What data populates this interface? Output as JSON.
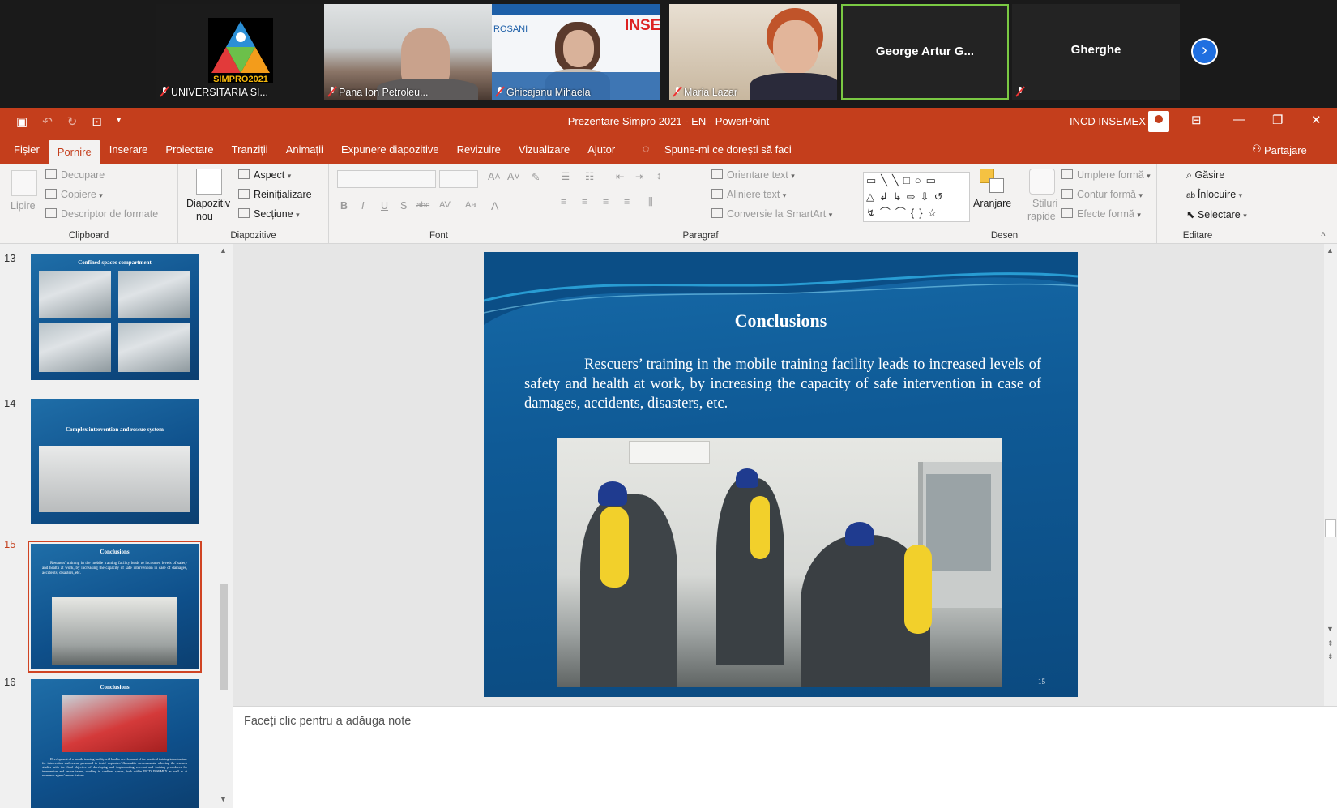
{
  "meeting": {
    "participants": [
      {
        "name": "UNIVERSITARIA SI...",
        "logo_text": "SIMPRO2021"
      },
      {
        "name": "Pana Ion Petroleu..."
      },
      {
        "name": "Ghicajanu Mihaela",
        "slide_text_left": "ROSANI",
        "slide_text_right": "INSE"
      },
      {
        "name": "Maria Lazar"
      },
      {
        "name": "George Artur G..."
      },
      {
        "name": "Gherghe"
      }
    ],
    "next_icon": "chevron-right-icon"
  },
  "app": {
    "title": "Prezentare Simpro 2021 - EN  -  PowerPoint",
    "user": "INCD INSEMEX",
    "qat": [
      "save-icon",
      "undo-icon",
      "redo-icon",
      "present-icon",
      "customize-icon"
    ]
  },
  "tabs": [
    "Fișier",
    "Pornire",
    "Inserare",
    "Proiectare",
    "Tranziții",
    "Animații",
    "Expunere diapozitive",
    "Revizuire",
    "Vizualizare",
    "Ajutor"
  ],
  "tell_me": "Spune-mi ce dorești să faci",
  "share": "Partajare",
  "ribbon": {
    "clipboard": {
      "label": "Clipboard",
      "paste": "Lipire",
      "cut": "Decupare",
      "copy": "Copiere",
      "format_painter": "Descriptor de formate"
    },
    "slides": {
      "label": "Diapozitive",
      "new_slide_1": "Diapozitiv",
      "new_slide_2": "nou",
      "layout": "Aspect",
      "reset": "Reinițializare",
      "section": "Secțiune"
    },
    "font": {
      "label": "Font",
      "bold": "B",
      "italic": "I",
      "underline": "U",
      "shadow": "S",
      "strike": "abc",
      "spacing": "AV",
      "case": "Aa",
      "color": "A"
    },
    "paragraph": {
      "label": "Paragraf",
      "text_direction": "Orientare text",
      "align_text": "Aliniere text",
      "smartart": "Conversie la SmartArt"
    },
    "drawing": {
      "label": "Desen",
      "arrange": "Aranjare",
      "quick_styles_1": "Stiluri",
      "quick_styles_2": "rapide",
      "fill": "Umplere formă",
      "outline": "Contur formă",
      "effects": "Efecte formă"
    },
    "editing": {
      "label": "Editare",
      "find": "Găsire",
      "replace": "Înlocuire",
      "select": "Selectare"
    }
  },
  "thumbnails": [
    {
      "num": "13",
      "title": "Confined spaces compartment"
    },
    {
      "num": "14",
      "title": "Complex intervention and rescue system"
    },
    {
      "num": "15",
      "title": "Conclusions",
      "text": "Rescuers' training in the mobile training facility leads to increased levels of safety and health at work, by increasing the capacity of safe intervention in case of damages, accidents, disasters, etc."
    },
    {
      "num": "16",
      "title": "Conclusions",
      "text": "Development of a mobile training facility will lead to development of the practical training infrastructure for intervention and rescue personnel in toxic/ explosive/ flammable environments, allowing the research studies with the final objective of developing and implementing relevant and training procedures for intervention and rescue teams, working in confined spaces, both within INCD INSEMEX as well as at economic agents' rescue stations."
    }
  ],
  "slide": {
    "title": "Conclusions",
    "body": "Rescuers’ training in the mobile training facility leads to increased levels of safety and health at work, by increasing the capacity of safe intervention in case of damages, accidents, disasters, etc.",
    "number": "15"
  },
  "notes_placeholder": "Faceți clic pentru a adăuga note"
}
